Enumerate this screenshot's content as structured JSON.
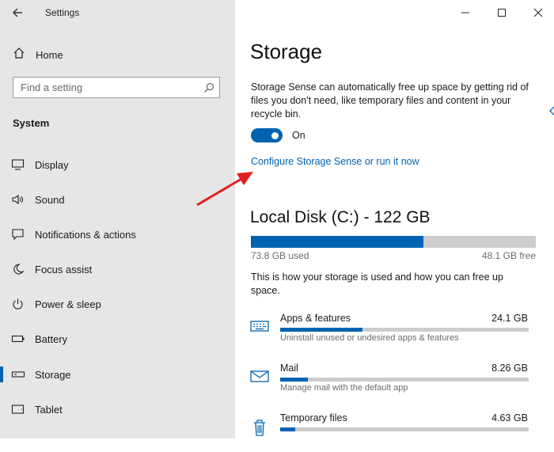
{
  "window": {
    "title": "Settings",
    "back_icon": "back-arrow-icon",
    "controls": [
      "minimize-icon",
      "maximize-icon",
      "close-icon"
    ]
  },
  "sidebar": {
    "home_label": "Home",
    "search_placeholder": "Find a setting",
    "section_heading": "System",
    "items": [
      {
        "label": "Display",
        "icon": "monitor-icon"
      },
      {
        "label": "Sound",
        "icon": "speaker-icon"
      },
      {
        "label": "Notifications & actions",
        "icon": "notification-icon"
      },
      {
        "label": "Focus assist",
        "icon": "moon-icon"
      },
      {
        "label": "Power & sleep",
        "icon": "power-icon"
      },
      {
        "label": "Battery",
        "icon": "battery-icon"
      },
      {
        "label": "Storage",
        "icon": "storage-icon",
        "active": true
      },
      {
        "label": "Tablet",
        "icon": "tablet-icon"
      }
    ]
  },
  "main": {
    "title": "Storage",
    "description": "Storage Sense can automatically free up space by getting rid of files you don't need, like temporary files and content in your recycle bin.",
    "toggle": {
      "state_label": "On",
      "on": true
    },
    "config_link": "Configure Storage Sense or run it now",
    "disk": {
      "title": "Local Disk (C:) - 122 GB",
      "used": "73.8 GB used",
      "free": "48.1 GB free",
      "used_fraction": 0.605
    },
    "usage_description": "This is how your storage is used and how you can free up space.",
    "categories": [
      {
        "name": "Apps & features",
        "size": "24.1 GB",
        "description": "Uninstall unused or undesired apps & features",
        "icon": "keyboard-icon",
        "fraction": 0.33
      },
      {
        "name": "Mail",
        "size": "8.26 GB",
        "description": "Manage mail with the default app",
        "icon": "mail-icon",
        "fraction": 0.11
      },
      {
        "name": "Temporary files",
        "size": "4.63 GB",
        "description": "",
        "icon": "trash-icon",
        "fraction": 0.06
      }
    ]
  },
  "colors": {
    "accent": "#0063b1",
    "sidebar_bg": "#e6e6e6",
    "bar_track": "#cccccc",
    "annotation_arrow": "#e02020"
  }
}
